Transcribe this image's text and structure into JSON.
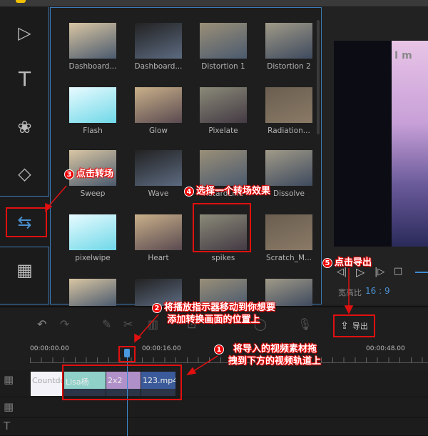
{
  "sidebar": {
    "items": [
      {
        "icon": "media-icon",
        "glyph": "▷"
      },
      {
        "icon": "text-icon",
        "glyph": "T"
      },
      {
        "icon": "filter-icon",
        "glyph": "❀"
      },
      {
        "icon": "overlay-icon",
        "glyph": "◇"
      },
      {
        "icon": "transition-icon",
        "glyph": "⇆",
        "selected": true
      },
      {
        "icon": "film-icon",
        "glyph": "▦"
      }
    ]
  },
  "transitions": {
    "items": [
      "Dashboard...",
      "Dashboard...",
      "Distortion 1",
      "Distortion 2",
      "Flash",
      "Glow",
      "Pixelate",
      "Radiation...",
      "Sweep",
      "Wave",
      "RetardLine",
      "Dissolve",
      "pixelwipe",
      "Heart",
      "spikes",
      "Scratch_M...",
      "",
      "",
      "",
      ""
    ],
    "selected": "spikes"
  },
  "preview": {
    "overlay_text": "I m",
    "ratio_label": "宽高比",
    "ratio_value": "16 : 9"
  },
  "toolbar": {
    "export_label": "导出"
  },
  "timeline": {
    "ticks": [
      "00:00:00.00",
      "00:00:16.00",
      "00:00:48.00"
    ],
    "clips": [
      "Countdown",
      "Lisa杨",
      "2x2",
      "123.mp4"
    ]
  },
  "annotations": {
    "a1": {
      "num": "1",
      "text1": "将导入的视频素材拖",
      "text2": "拽到下方的视频轨道上"
    },
    "a2": {
      "num": "2",
      "text1": "将播放指示器移动到你想要",
      "text2": "添加转换画面的位置上"
    },
    "a3": {
      "num": "3",
      "text": "点击转场"
    },
    "a4": {
      "num": "4",
      "text": "选择一个转场效果"
    },
    "a5": {
      "num": "5",
      "text": "点击导出"
    }
  },
  "colors": {
    "accent": "#3d7ab8",
    "annotation": "#e01010"
  }
}
